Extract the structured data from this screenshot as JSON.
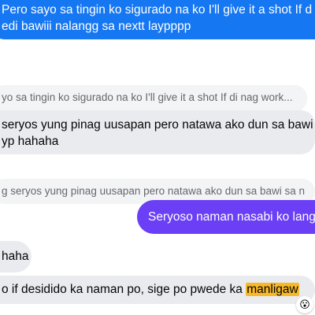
{
  "messages": [
    {
      "type": "sent",
      "lines": [
        "Pero sayo sa tingin ko sigurado na ko I'll give it a shot If d",
        "edi bawiii nalangg sa nextt laypppp"
      ]
    },
    {
      "type": "received",
      "reply_preview": "yo sa tingin ko sigurado na ko I'll give it a shot If di nag work...",
      "lines": [
        "seryos yung pinag uusapan pero natawa ako dun sa bawi",
        "yp hahaha"
      ]
    },
    {
      "type": "sent",
      "reply_preview": "g seryos yung pinag uusapan pero natawa ako dun sa bawi sa n",
      "lines": [
        "Seryoso naman nasabi ko lang"
      ]
    },
    {
      "type": "received",
      "lines": [
        "haha"
      ]
    },
    {
      "type": "received",
      "text_before": "o if desidido ka naman po, sige po pwede ka ",
      "highlight": "manligaw",
      "reaction": "😮"
    }
  ]
}
